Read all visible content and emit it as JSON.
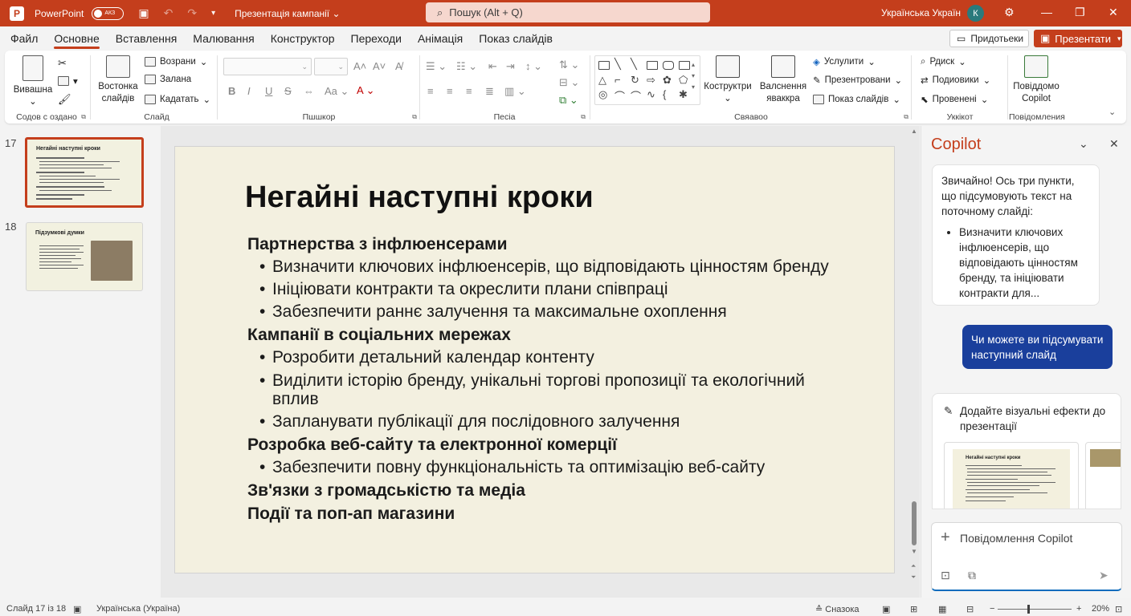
{
  "titlebar": {
    "app_name": "PowerPoint",
    "autosave_label": "АКЗ",
    "doc_title": "Презентація кампанії",
    "search_placeholder": "Пошук (Alt + Q)",
    "language": "Українська Україн",
    "avatar_initial": "К"
  },
  "menu": {
    "tabs": [
      "Файл",
      "Основне",
      "Вставлення",
      "Малювання",
      "Конструктор",
      "Переходи",
      "Анімація",
      "Показ слайдів"
    ],
    "active_tab": "Основне",
    "comments_label": "Придотьеки",
    "present_label": "Презентати"
  },
  "ribbon": {
    "clipboard": {
      "paste_label": "Вивашна",
      "group_label": "Содов с оздано"
    },
    "slides": {
      "new_slide_label": "Востонка слайдів",
      "layout_label": "Возрани",
      "reset_label": "Залана",
      "section_label": "Кадатать",
      "group_label": "Слайд"
    },
    "font": {
      "group_label": "Пшшкор"
    },
    "paragraph": {
      "group_label": "Песіа"
    },
    "drawing": {
      "arrange_label": "Коструктри",
      "styles_label": "Валснення яваккра",
      "fill_label": "Услулити",
      "outline_label": "Презентровани",
      "effects_label": "Показ слайдів",
      "group_label": "Свяавоо"
    },
    "editing": {
      "find_label": "Рдиск",
      "replace_label": "Подиовики",
      "select_label": "Провенені",
      "group_label": "Уккікот"
    },
    "copilot": {
      "label": "Повіддомо Copilot",
      "group_label": "Повідомления"
    }
  },
  "thumbnails": [
    {
      "number": "17",
      "title": "Негайні наступні кроки",
      "selected": true
    },
    {
      "number": "18",
      "title": "Підзумкові думки",
      "selected": false
    }
  ],
  "slide": {
    "title": "Негайні наступні кроки",
    "sections": [
      {
        "heading": "Партнерства з інфлюенсерами",
        "bullets": [
          "Визначити ключових інфлюенсерів, що відповідають цінностям бренду",
          "Ініціювати контракти та окреслити плани співпраці",
          "Забезпечити раннє залучення та максимальне охоплення"
        ]
      },
      {
        "heading": "Кампанії в соціальних мережах",
        "bullets": [
          "Розробити детальний календар контенту",
          "Виділити історію бренду, унікальні торгові пропозиції та екологічний вплив",
          "Запланувати публікації для послідовного залучення"
        ]
      },
      {
        "heading": "Розробка веб-сайту та електронної комерції",
        "bullets": [
          "Забезпечити повну функціональність та оптимізацію веб-сайту"
        ]
      },
      {
        "heading": "Зв'язки з громадськістю та медіа",
        "bullets": []
      },
      {
        "heading": "Події та поп-ап магазини",
        "bullets": []
      }
    ]
  },
  "copilot": {
    "title": "Copilot",
    "assistant_message": "Звичайно! Ось три пункти, що підсумовують текст на поточному слайді:",
    "assistant_bullet": "Визначити ключових інфлюенсерів, що відповідають цінностям бренду, та ініціювати контракти для...",
    "user_message": "Чи можете ви підсумувати наступний слайд",
    "suggestion": "Додайте візуальні ефекти до презентації",
    "suggestion_thumb_title": "Негайні наступні кроки",
    "input_placeholder": "Повідомлення Copilot"
  },
  "statusbar": {
    "slide_position": "Слайд 17 із 18",
    "language": "Українська (Україна)",
    "notes_label": "Сназока",
    "zoom": "20%"
  },
  "colors": {
    "accent": "#c43e1c",
    "user_bubble": "#1a3f9c",
    "slide_bg": "#f3f0e0"
  }
}
